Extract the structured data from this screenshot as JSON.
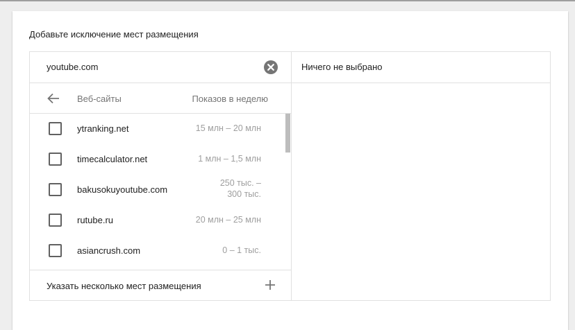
{
  "title": "Добавьте исключение мест размещения",
  "search": {
    "value": "youtube.com"
  },
  "list_header": {
    "back_icon": "arrow-left-icon",
    "col_sites": "Веб-сайты",
    "col_impressions": "Показов в неделю"
  },
  "rows": [
    {
      "site": "ytranking.net",
      "impressions": "15 млн – 20 млн",
      "checked": false
    },
    {
      "site": "timecalculator.net",
      "impressions": "1 млн – 1,5 млн",
      "checked": false
    },
    {
      "site": "bakusokuyoutube.com",
      "impressions_line1": "250 тыс. –",
      "impressions_line2": "300 тыс.",
      "checked": false
    },
    {
      "site": "rutube.ru",
      "impressions": "20 млн – 25 млн",
      "checked": false
    },
    {
      "site": "asiancrush.com",
      "impressions": "0 – 1 тыс.",
      "checked": false
    }
  ],
  "footer": {
    "label": "Указать несколько мест размещения",
    "icon": "plus-icon"
  },
  "selected_panel": {
    "empty_text": "Ничего не выбрано"
  },
  "colors": {
    "border": "#e0e0e0",
    "muted": "#757575",
    "light": "#9e9e9e",
    "icon": "#757575"
  }
}
